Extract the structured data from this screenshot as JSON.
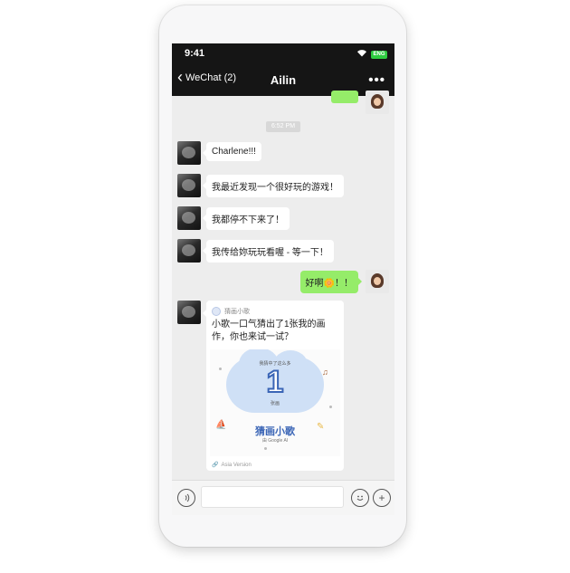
{
  "status_bar": {
    "time": "9:41",
    "battery_label": "ENG"
  },
  "nav": {
    "back_label": "WeChat (2)",
    "title": "Ailin",
    "more": "•••"
  },
  "chat": {
    "timestamp": "6:52 PM",
    "messages": [
      {
        "sender": "charlene",
        "text": "Charlene!!!"
      },
      {
        "sender": "charlene",
        "text": "我最近发现一个很好玩的游戏！"
      },
      {
        "sender": "charlene",
        "text": "我都停不下来了！"
      },
      {
        "sender": "charlene",
        "text": "我传给妳玩玩看喔 - 等一下！"
      },
      {
        "sender": "ailin",
        "text": "好啊🌼！！"
      }
    ],
    "card": {
      "source": "猜画小歌",
      "text": "小歌一口气猜出了1张我的画作，你也来试一试？",
      "image_caption_top": "我猜中了这么多",
      "image_number": "1",
      "image_unit": "张画",
      "game_title": "猜画小歌",
      "google_ai": "由 Google AI",
      "footer": "Asia Version"
    }
  },
  "input_bar": {
    "placeholder": ""
  },
  "colors": {
    "accent_green": "#95ec69",
    "navbar": "#151515",
    "chat_bg": "#ededed"
  },
  "icons": [
    "wifi-icon",
    "battery-icon",
    "chevron-left-icon",
    "more-icon",
    "voice-icon",
    "emoji-icon",
    "plus-icon",
    "link-icon"
  ]
}
